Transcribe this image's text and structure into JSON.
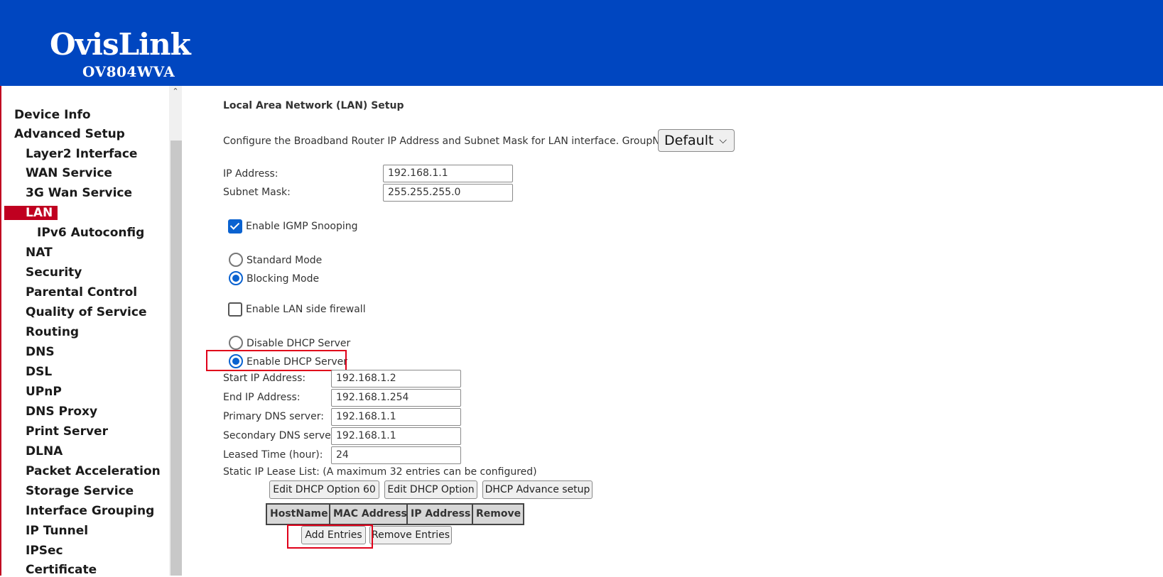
{
  "header": {
    "brand": "OvisLink",
    "model": "OV804WVA",
    "background": "#0046c0"
  },
  "sidebar": {
    "items": [
      {
        "label": "Device Info",
        "level": 0
      },
      {
        "label": "Advanced Setup",
        "level": 0
      },
      {
        "label": "Layer2 Interface",
        "level": 1
      },
      {
        "label": "WAN Service",
        "level": 1
      },
      {
        "label": "3G Wan Service",
        "level": 1
      },
      {
        "label": "LAN",
        "level": 1,
        "active": true
      },
      {
        "label": "IPv6 Autoconfig",
        "level": 2
      },
      {
        "label": "NAT",
        "level": 1
      },
      {
        "label": "Security",
        "level": 1
      },
      {
        "label": "Parental Control",
        "level": 1
      },
      {
        "label": "Quality of Service",
        "level": 1
      },
      {
        "label": "Routing",
        "level": 1
      },
      {
        "label": "DNS",
        "level": 1
      },
      {
        "label": "DSL",
        "level": 1
      },
      {
        "label": "UPnP",
        "level": 1
      },
      {
        "label": "DNS Proxy",
        "level": 1
      },
      {
        "label": "Print Server",
        "level": 1
      },
      {
        "label": "DLNA",
        "level": 1
      },
      {
        "label": "Packet Acceleration",
        "level": 1
      },
      {
        "label": "Storage Service",
        "level": 1
      },
      {
        "label": "Interface Grouping",
        "level": 1
      },
      {
        "label": "IP Tunnel",
        "level": 1
      },
      {
        "label": "IPSec",
        "level": 1
      },
      {
        "label": "Certificate",
        "level": 1
      }
    ],
    "active_color": "#c00020"
  },
  "main": {
    "title": "Local Area Network (LAN) Setup",
    "description": "Configure the Broadband Router IP Address and Subnet Mask for LAN interface.  GroupName",
    "group_name": "Default",
    "ip_address": {
      "label": "IP Address:",
      "value": "192.168.1.1"
    },
    "subnet_mask": {
      "label": "Subnet Mask:",
      "value": "255.255.255.0"
    },
    "igmp_snooping": {
      "label": "Enable IGMP Snooping",
      "checked": true
    },
    "mode": {
      "options": [
        "Standard Mode",
        "Blocking Mode"
      ],
      "selected": "Blocking Mode"
    },
    "lan_firewall": {
      "label": "Enable LAN side firewall",
      "checked": false
    },
    "dhcp": {
      "options": [
        "Disable DHCP Server",
        "Enable DHCP Server"
      ],
      "selected": "Enable DHCP Server"
    },
    "dhcp_fields": [
      {
        "label": "Start IP Address:",
        "value": "192.168.1.2"
      },
      {
        "label": "End IP Address:",
        "value": "192.168.1.254"
      },
      {
        "label": "Primary DNS server:",
        "value": "192.168.1.1"
      },
      {
        "label": "Secondary DNS server:",
        "value": "192.168.1.1"
      },
      {
        "label": "Leased Time (hour):",
        "value": "24"
      }
    ],
    "lease_list_text": "Static IP Lease List: (A maximum 32 entries can be configured)",
    "option_buttons": [
      "Edit DHCP Option 60",
      "Edit DHCP Option",
      "DHCP Advance setup"
    ],
    "lease_table": {
      "columns": [
        "HostName",
        "MAC Address",
        "IP Address",
        "Remove"
      ]
    },
    "entry_buttons": {
      "add": "Add Entries",
      "remove": "Remove Entries"
    },
    "accent_color": "#0a62d0",
    "highlight_color": "#e0001a"
  }
}
